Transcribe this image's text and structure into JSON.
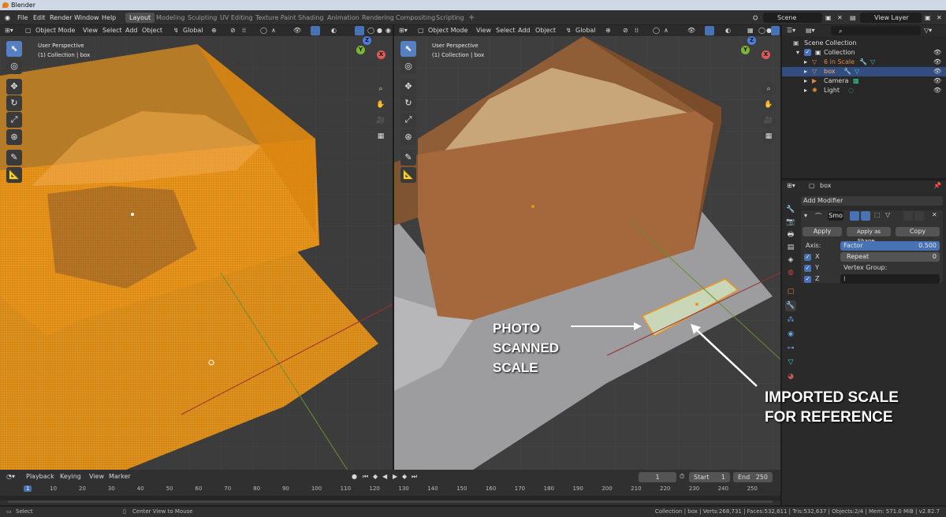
{
  "window_title": "Blender",
  "menu": [
    "File",
    "Edit",
    "Render",
    "Window",
    "Help"
  ],
  "workspaces": [
    "Layout",
    "Modeling",
    "Sculpting",
    "UV Editing",
    "Texture Paint",
    "Shading",
    "Animation",
    "Rendering",
    "Compositing",
    "Scripting"
  ],
  "scene": {
    "label": "Scene",
    "view_layer": "View Layer"
  },
  "viewport_header": {
    "mode": "Object Mode",
    "items": [
      "View",
      "Select",
      "Add",
      "Object"
    ],
    "orientation": "Global"
  },
  "viewports": [
    {
      "view": "User Perspective",
      "collection": "(1) Collection | box"
    },
    {
      "view": "User Perspective",
      "collection": "(1) Collection | box"
    }
  ],
  "gizmo": {
    "y": "Y",
    "x": "X",
    "z": "Z"
  },
  "outliner": {
    "scene_collection": "Scene Collection",
    "collection": "Collection",
    "items": [
      {
        "name": "6 in Scale",
        "selected": false,
        "color": "#e08a3c"
      },
      {
        "name": "box",
        "selected": true,
        "color": "#e08a3c"
      },
      {
        "name": "Camera",
        "selected": false,
        "color": "#d0d0d0"
      },
      {
        "name": "Light",
        "selected": false,
        "color": "#d0d0d0"
      }
    ]
  },
  "properties": {
    "object": "box",
    "add_modifier": "Add Modifier",
    "modifier_name": "Smo",
    "apply": "Apply",
    "apply_shape": "Apply as Shape...",
    "copy": "Copy",
    "axis_label": "Axis:",
    "axes": [
      "X",
      "Y",
      "Z"
    ],
    "factor_label": "Factor",
    "factor_value": "0.500",
    "repeat_label": "Repeat",
    "repeat_value": "0",
    "vertex_group": "Vertex Group:"
  },
  "timeline": {
    "menus": [
      "Playback",
      "Keying",
      "View",
      "Marker"
    ],
    "current_frame": "1",
    "start_label": "Start",
    "start": "1",
    "end_label": "End",
    "end": "250",
    "ticks": [
      "1",
      "10",
      "20",
      "30",
      "40",
      "50",
      "60",
      "70",
      "80",
      "90",
      "100",
      "110",
      "120",
      "130",
      "140",
      "150",
      "160",
      "170",
      "180",
      "190",
      "200",
      "210",
      "220",
      "230",
      "240",
      "250"
    ]
  },
  "statusbar": {
    "left": "Select",
    "middle": "Center View to Mouse",
    "right": "Collection | box | Verts:268,731 | Faces:532,611 | Tris:532,637 | Objects:2/4 | Mem: 571.0 MiB | v2.82.7"
  },
  "annotations": {
    "photo_lines": [
      "PHOTO",
      "SCANNED",
      "SCALE"
    ],
    "imported_lines": [
      "IMPORTED SCALE",
      "FOR REFERENCE"
    ]
  },
  "colors": {
    "accent": "#4772b3",
    "selected_row": "#334d80",
    "orange_mesh": "#e8951c",
    "active_ws": "#505050"
  }
}
